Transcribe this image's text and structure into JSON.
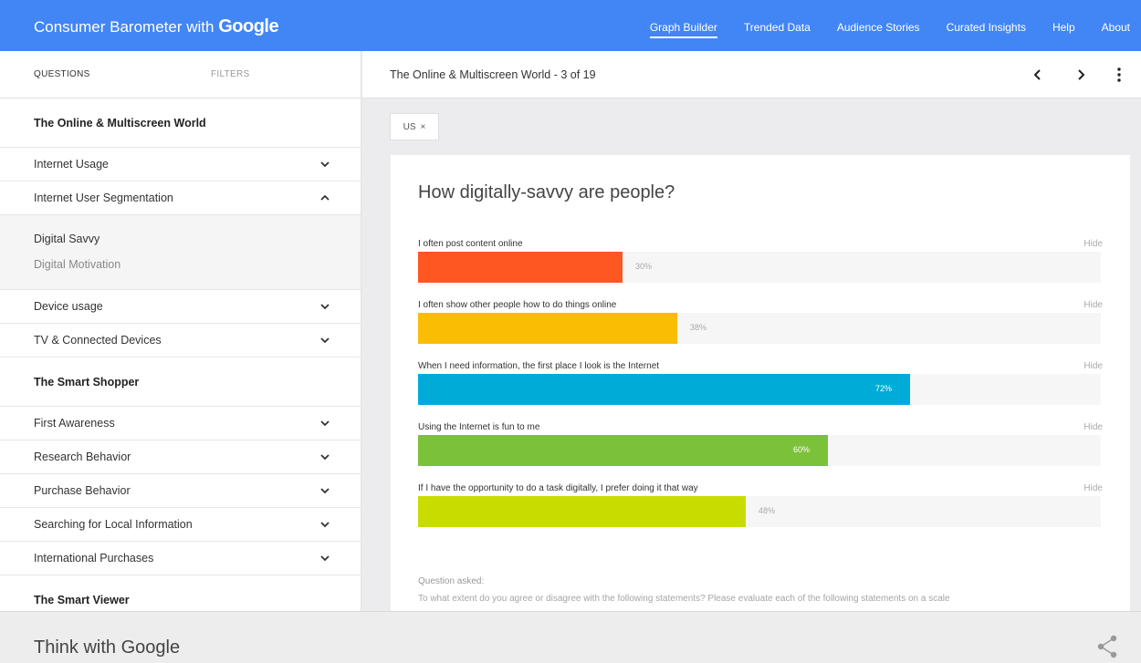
{
  "header": {
    "brand_prefix": "Consumer Barometer with",
    "brand_google": "Google",
    "nav": [
      {
        "label": "Graph Builder",
        "active": true
      },
      {
        "label": "Trended Data"
      },
      {
        "label": "Audience Stories"
      },
      {
        "label": "Curated Insights"
      },
      {
        "label": "Help"
      },
      {
        "label": "About"
      }
    ]
  },
  "sidebar": {
    "tabs": {
      "questions": "QUESTIONS",
      "filters": "FILTERS"
    },
    "section1": "The Online & Multiscreen World",
    "items1": [
      "Internet Usage",
      "Internet User Segmentation"
    ],
    "sub": {
      "current": "Digital Savvy",
      "other": "Digital Motivation"
    },
    "items2": [
      "Device usage",
      "TV & Connected Devices"
    ],
    "section2": "The Smart Shopper",
    "items3": [
      "First Awareness",
      "Research Behavior",
      "Purchase Behavior",
      "Searching for Local Information",
      "International Purchases"
    ],
    "section3": "The Smart Viewer"
  },
  "main": {
    "title": "The Online & Multiscreen World - 3 of 19",
    "filter_chip": "US",
    "chip_close": "×",
    "question": "How digitally-savvy are people?",
    "hide_label": "Hide",
    "qa_label": "Question asked:",
    "qa_text": "To what extent do you agree or disagree with the following statements? Please evaluate each of the following statements on a scale"
  },
  "chart_data": {
    "type": "bar",
    "orientation": "horizontal",
    "title": "How digitally-savvy are people?",
    "categories": [
      "I often post content online",
      "I often show other people how to do things online",
      "When I need information, the first place I look is the Internet",
      "Using the Internet is fun to me",
      "If I have the opportunity to do a task digitally, I prefer doing it that way"
    ],
    "values": [
      30,
      38,
      72,
      60,
      48
    ],
    "value_labels": [
      "30%",
      "38%",
      "72%",
      "60%",
      "48%"
    ],
    "colors": [
      "#ff5722",
      "#fbbc04",
      "#00acd7",
      "#7cc13a",
      "#c9dc00"
    ],
    "xlim": [
      0,
      100
    ]
  },
  "footer": {
    "brand": "Think with Google"
  },
  "icons": {
    "chevron_down": "chevron-down-icon",
    "chevron_up": "chevron-up-icon",
    "prev": "chevron-left-icon",
    "next": "chevron-right-icon",
    "more": "more-vert-icon",
    "share": "share-icon"
  }
}
